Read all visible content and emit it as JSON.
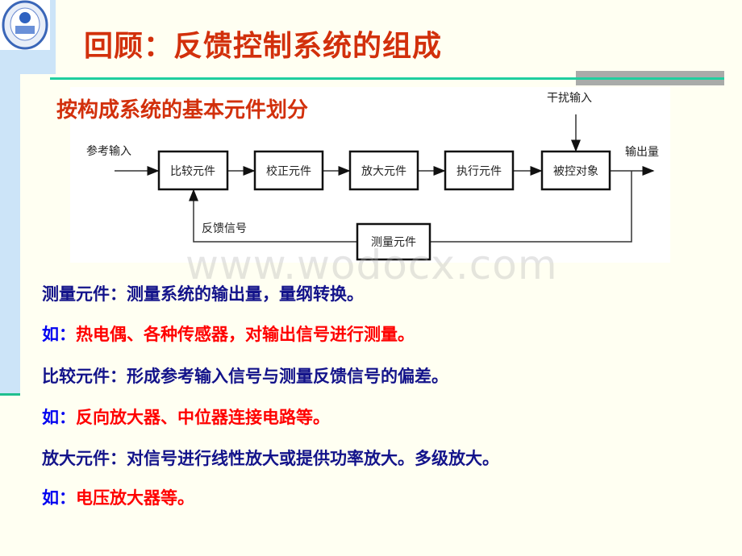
{
  "title": "回顾：反馈控制系统的组成",
  "subtitle": "按构成系统的基本元件划分",
  "diagram": {
    "reference_input": "参考输入",
    "disturbance_input": "干扰输入",
    "output": "输出量",
    "feedback_signal": "反馈信号",
    "blocks": [
      "比较元件",
      "校正元件",
      "放大元件",
      "执行元件",
      "被控对象"
    ],
    "measure_block": "测量元件"
  },
  "watermark": "www.wodocx.com",
  "lines": [
    {
      "label": "测量元件：",
      "text": "测量系统的输出量，量纲转换。",
      "style": "def"
    },
    {
      "label": "如：",
      "text": "热电偶、各种传感器，对输出信号进行测量。",
      "style": "example"
    },
    {
      "label": "比较元件：",
      "text": "形成参考输入信号与测量反馈信号的偏差。",
      "style": "def"
    },
    {
      "label": "如：",
      "text": "反向放大器、中位器连接电路等。",
      "style": "example"
    },
    {
      "label": "放大元件：",
      "text": "对信号进行线性放大或提供功率放大。多级放大。",
      "style": "def"
    },
    {
      "label": "如：",
      "text": "电压放大器等。",
      "style": "example"
    }
  ],
  "colors": {
    "title": "#D2300C",
    "definition": "#13138A",
    "example_label": "#0000F0",
    "example_text": "#FF0000",
    "accent_line": "#1FCF9F"
  }
}
